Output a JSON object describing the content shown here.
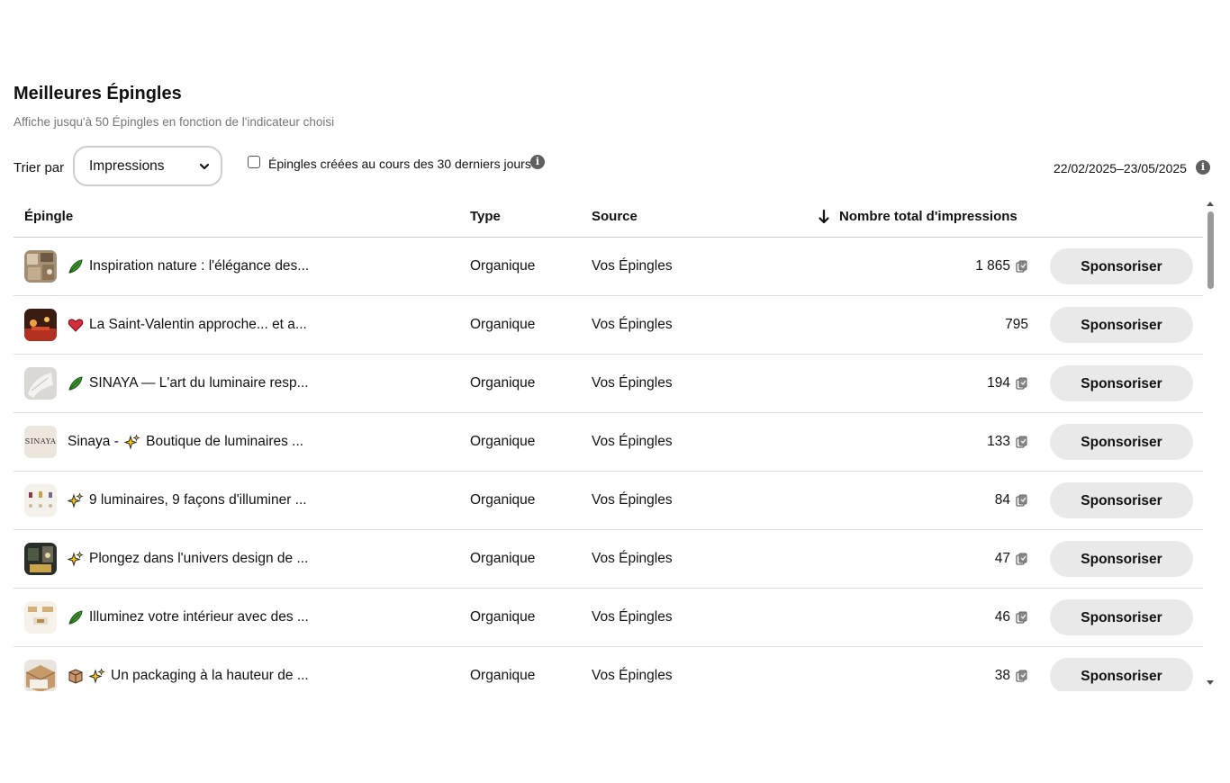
{
  "header": {
    "title": "Meilleures Épingles",
    "subtitle": "Affiche jusqu'à 50 Épingles en fonction de l'indicateur choisi"
  },
  "controls": {
    "sort_label": "Trier par",
    "sort_value": "Impressions",
    "checkbox_label": "Épingles créées au cours des 30 derniers jours",
    "checkbox_checked": false,
    "date_range": "22/02/2025–23/05/2025"
  },
  "table": {
    "columns": {
      "pin": "Épingle",
      "type": "Type",
      "source": "Source",
      "impressions": "Nombre total d'impressions"
    },
    "rows": [
      {
        "title": "Inspiration nature : l'élégance des...",
        "emoji": "leaf",
        "type": "Organique",
        "source": "Vos Épingles",
        "impressions": "1 865",
        "copy_icon": true,
        "action": "Sponsoriser"
      },
      {
        "title": "La Saint-Valentin approche... et a...",
        "emoji": "heart",
        "type": "Organique",
        "source": "Vos Épingles",
        "impressions": "795",
        "copy_icon": false,
        "action": "Sponsoriser"
      },
      {
        "title": "SINAYA — L'art du luminaire resp...",
        "emoji": "leaf",
        "type": "Organique",
        "source": "Vos Épingles",
        "impressions": "194",
        "copy_icon": true,
        "action": "Sponsoriser"
      },
      {
        "title": "Sinaya -  Boutique de luminaires ...",
        "emoji": "sparkles-inline",
        "type": "Organique",
        "source": "Vos Épingles",
        "impressions": "133",
        "copy_icon": true,
        "action": "Sponsoriser"
      },
      {
        "title": "9 luminaires, 9 façons d'illuminer ...",
        "emoji": "sparkles",
        "type": "Organique",
        "source": "Vos Épingles",
        "impressions": "84",
        "copy_icon": true,
        "action": "Sponsoriser"
      },
      {
        "title": "Plongez dans l'univers design de ...",
        "emoji": "sparkles",
        "type": "Organique",
        "source": "Vos Épingles",
        "impressions": "47",
        "copy_icon": true,
        "action": "Sponsoriser"
      },
      {
        "title": "Illuminez votre intérieur avec des ...",
        "emoji": "leaf",
        "type": "Organique",
        "source": "Vos Épingles",
        "impressions": "46",
        "copy_icon": true,
        "action": "Sponsoriser"
      },
      {
        "title": "Un packaging à la hauteur de ...",
        "emoji": "box-sparkles",
        "type": "Organique",
        "source": "Vos Épingles",
        "impressions": "38",
        "copy_icon": true,
        "action": "Sponsoriser"
      }
    ]
  },
  "thumb4_logo": "SINAYA"
}
